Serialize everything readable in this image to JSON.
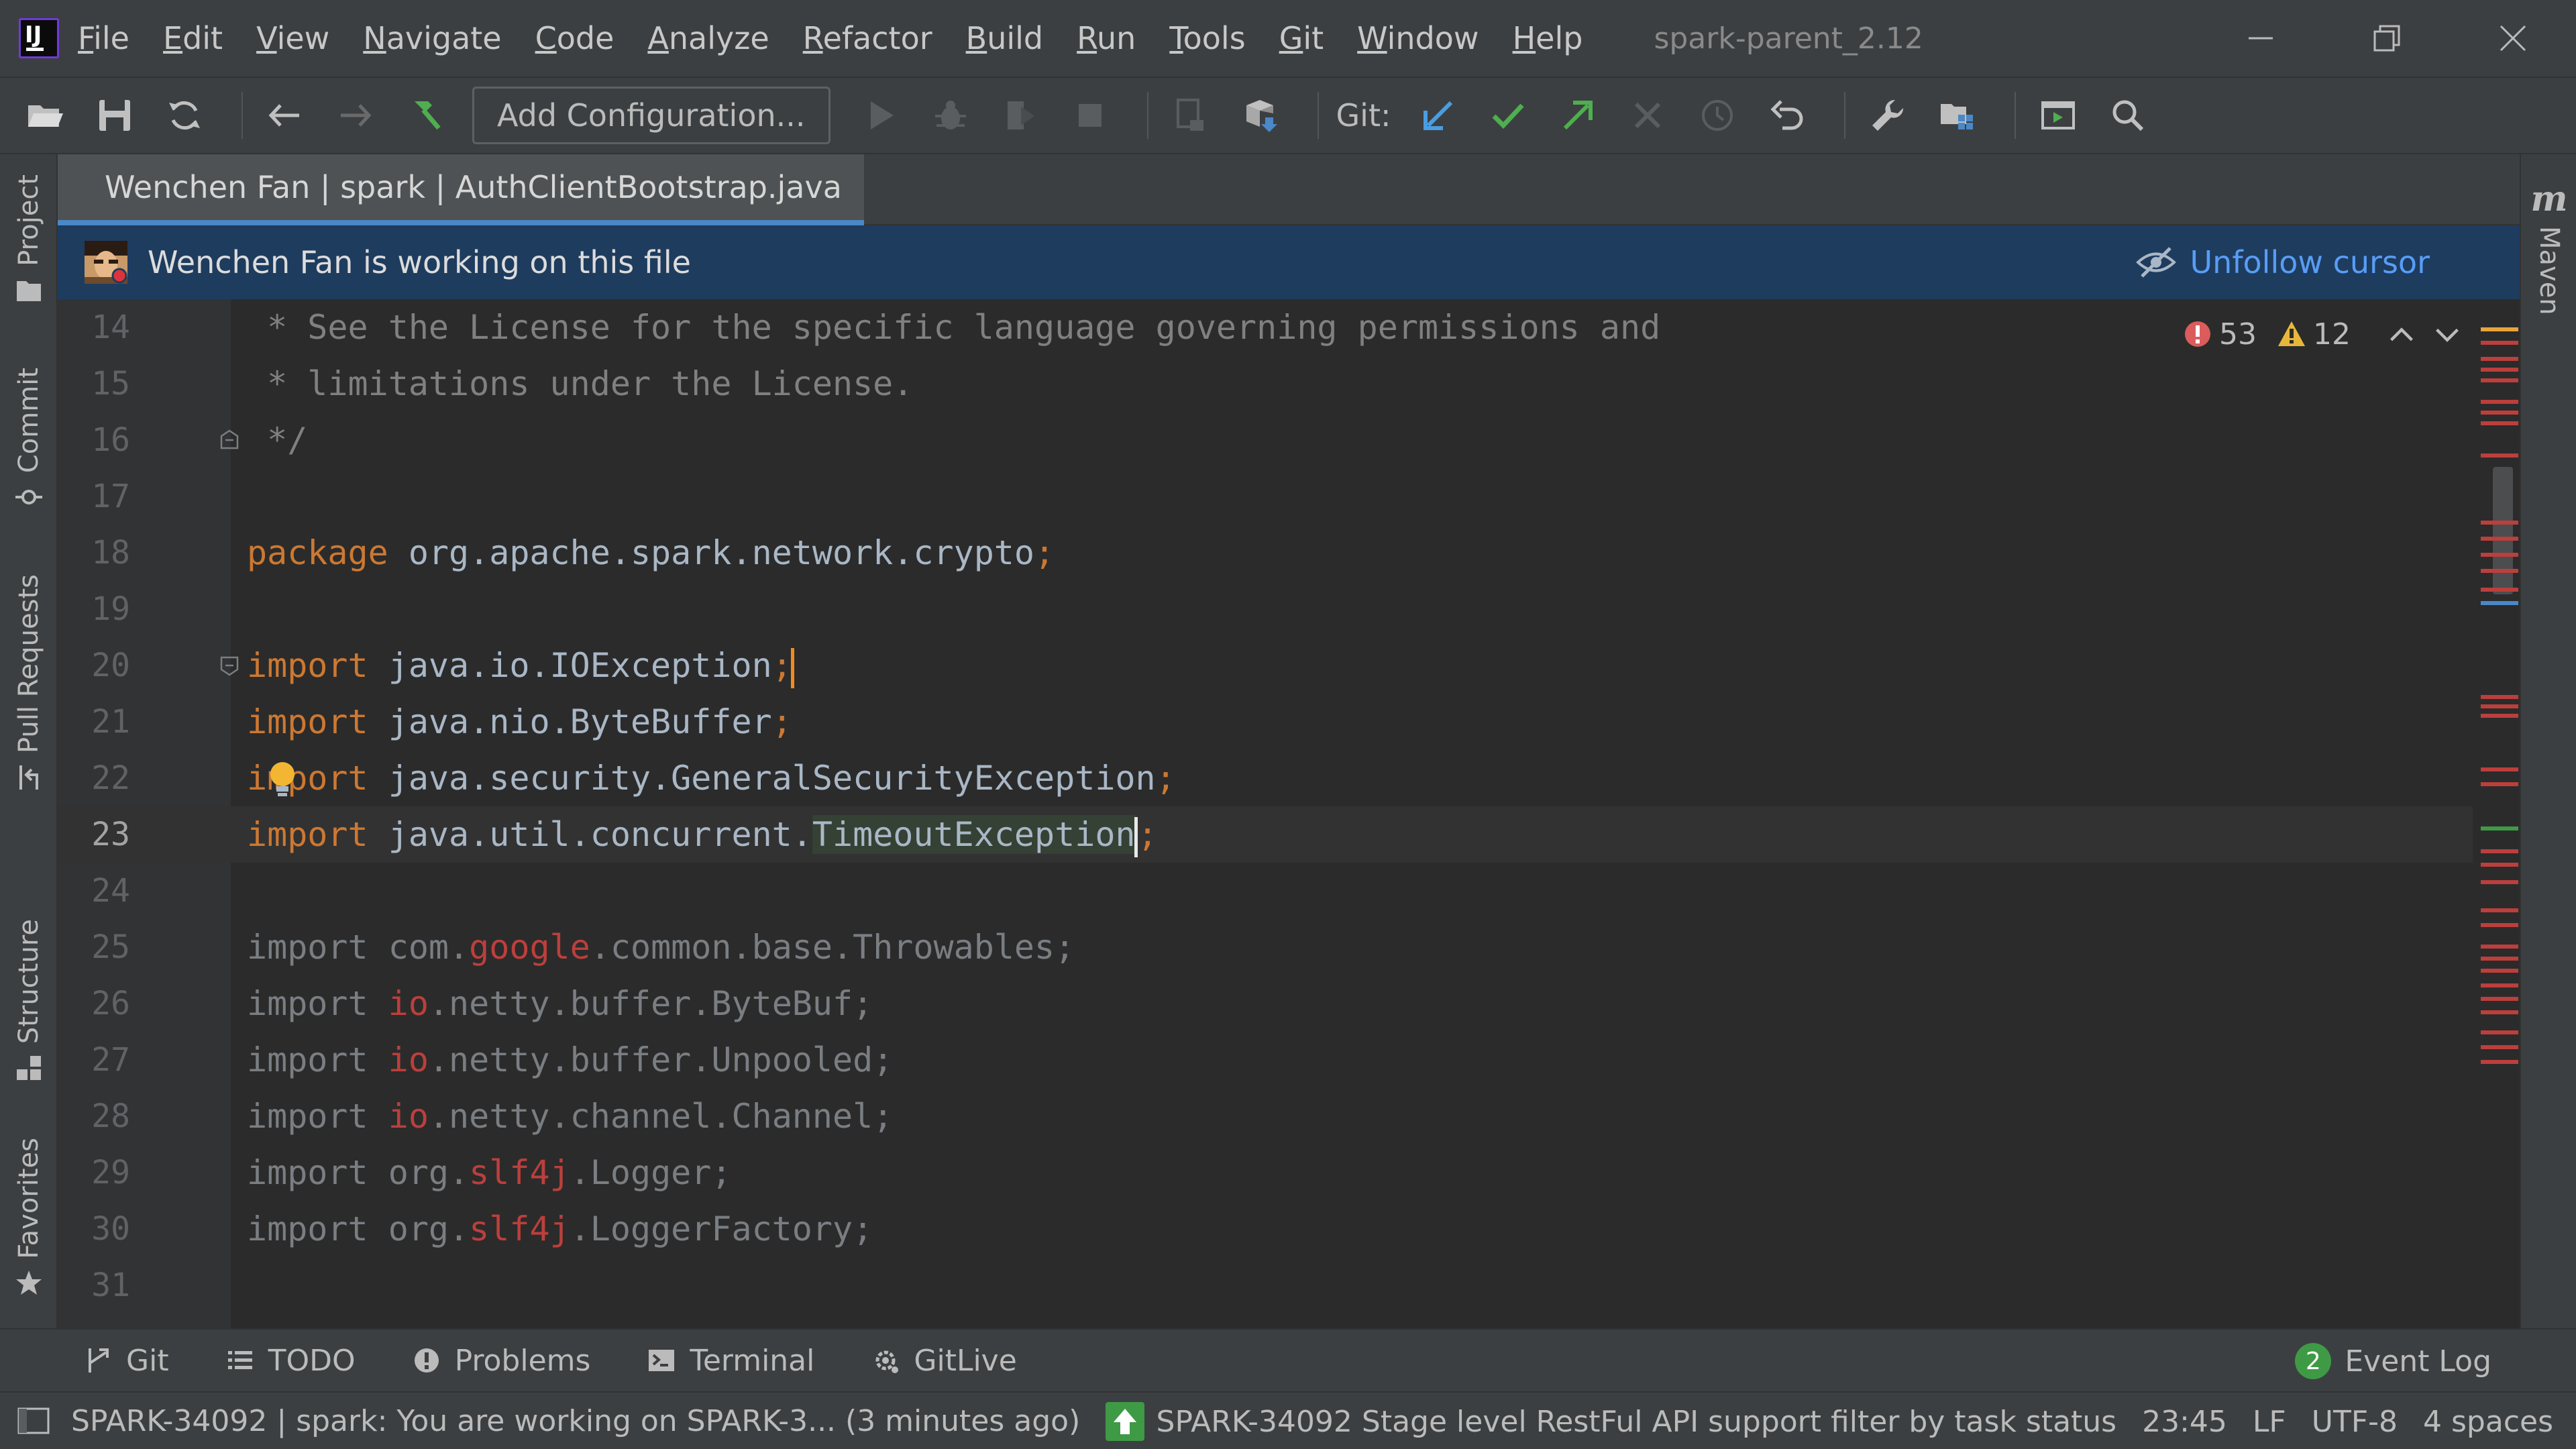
{
  "window": {
    "title": "spark-parent_2.12",
    "logo_text": "IJ"
  },
  "menu": [
    {
      "label": "File",
      "mnemonic_index": 0
    },
    {
      "label": "Edit",
      "mnemonic_index": 0
    },
    {
      "label": "View",
      "mnemonic_index": 0
    },
    {
      "label": "Navigate",
      "mnemonic_index": 0
    },
    {
      "label": "Code",
      "mnemonic_index": 0
    },
    {
      "label": "Analyze",
      "mnemonic_index": 0
    },
    {
      "label": "Refactor",
      "mnemonic_index": 0
    },
    {
      "label": "Build",
      "mnemonic_index": 0
    },
    {
      "label": "Run",
      "mnemonic_index": 0
    },
    {
      "label": "Tools",
      "mnemonic_index": 0
    },
    {
      "label": "Git",
      "mnemonic_index": 0
    },
    {
      "label": "Window",
      "mnemonic_index": 0
    },
    {
      "label": "Help",
      "mnemonic_index": 0
    }
  ],
  "toolbar": {
    "add_configuration": "Add Configuration...",
    "git_label": "Git:"
  },
  "left_tools": [
    {
      "label": "Project",
      "icon": "folder-icon"
    },
    {
      "label": "Commit",
      "icon": "commit-icon"
    },
    {
      "label": "Pull Requests",
      "icon": "pull-request-icon"
    },
    {
      "label": "Structure",
      "icon": "structure-icon"
    },
    {
      "label": "Favorites",
      "icon": "star-icon"
    }
  ],
  "right_tools": {
    "maven_icon": "m",
    "maven_label": "Maven"
  },
  "editor_tab": {
    "label": "Wenchen Fan | spark | AuthClientBootstrap.java"
  },
  "follow_banner": {
    "text": "Wenchen Fan is working on this file",
    "unfollow": "Unfollow cursor"
  },
  "inspection": {
    "errors": "53",
    "warnings": "12"
  },
  "code_lines": [
    {
      "n": "14",
      "text": " * See the License for the specific language governing permissions and"
    },
    {
      "n": "15",
      "text": " * limitations under the License."
    },
    {
      "n": "16",
      "text": " */"
    },
    {
      "n": "17",
      "text": ""
    },
    {
      "n": "18",
      "kw": "package",
      "text": " org.apache.spark.network.crypto",
      "semi": ";"
    },
    {
      "n": "19",
      "text": ""
    },
    {
      "n": "20",
      "kw": "import",
      "text": " java.io.IOException",
      "semi": ";"
    },
    {
      "n": "21",
      "kw": "import",
      "text": " java.nio.ByteBuffer",
      "semi": ";"
    },
    {
      "n": "22",
      "kw": "import",
      "text": " java.security.GeneralSecurityException",
      "semi": ";"
    },
    {
      "n": "23",
      "kw": "import",
      "text_a": " java.util.concurrent.",
      "text_b": "TimeoutException",
      "semi": ";"
    },
    {
      "n": "24",
      "text": ""
    },
    {
      "n": "25",
      "kw": "import",
      "pre": " com.",
      "err": "google",
      "post": ".common.base.Throwables;"
    },
    {
      "n": "26",
      "kw": "import",
      "pre": " ",
      "err": "io",
      "post": ".netty.buffer.ByteBuf;"
    },
    {
      "n": "27",
      "kw": "import",
      "pre": " ",
      "err": "io",
      "post": ".netty.buffer.Unpooled;"
    },
    {
      "n": "28",
      "kw": "import",
      "pre": " ",
      "err": "io",
      "post": ".netty.channel.Channel;"
    },
    {
      "n": "29",
      "kw": "import",
      "pre": " org.",
      "err": "slf4j",
      "post": ".Logger;"
    },
    {
      "n": "30",
      "kw": "import",
      "pre": " org.",
      "err": "slf4j",
      "post": ".LoggerFactory;"
    },
    {
      "n": "31",
      "text": ""
    }
  ],
  "bottom_tools": [
    {
      "label": "Git",
      "icon": "git-branch-icon"
    },
    {
      "label": "TODO",
      "icon": "list-icon"
    },
    {
      "label": "Problems",
      "icon": "problems-icon"
    },
    {
      "label": "Terminal",
      "icon": "terminal-icon"
    },
    {
      "label": "GitLive",
      "icon": "gitlive-icon"
    }
  ],
  "event_log": {
    "count": "2",
    "label": "Event Log"
  },
  "status": {
    "message": "SPARK-34092 | spark: You are working on SPARK-3... (3 minutes ago)",
    "task": "SPARK-34092 Stage level RestFul API support filter by task status",
    "position": "23:45",
    "line_sep": "LF",
    "encoding": "UTF-8",
    "indent": "4 spaces"
  },
  "colors": {
    "accent": "#4a88c7",
    "keyword": "#cc7832",
    "error": "#bc3f3c",
    "banner": "#1e3c5e",
    "link": "#589df6"
  }
}
